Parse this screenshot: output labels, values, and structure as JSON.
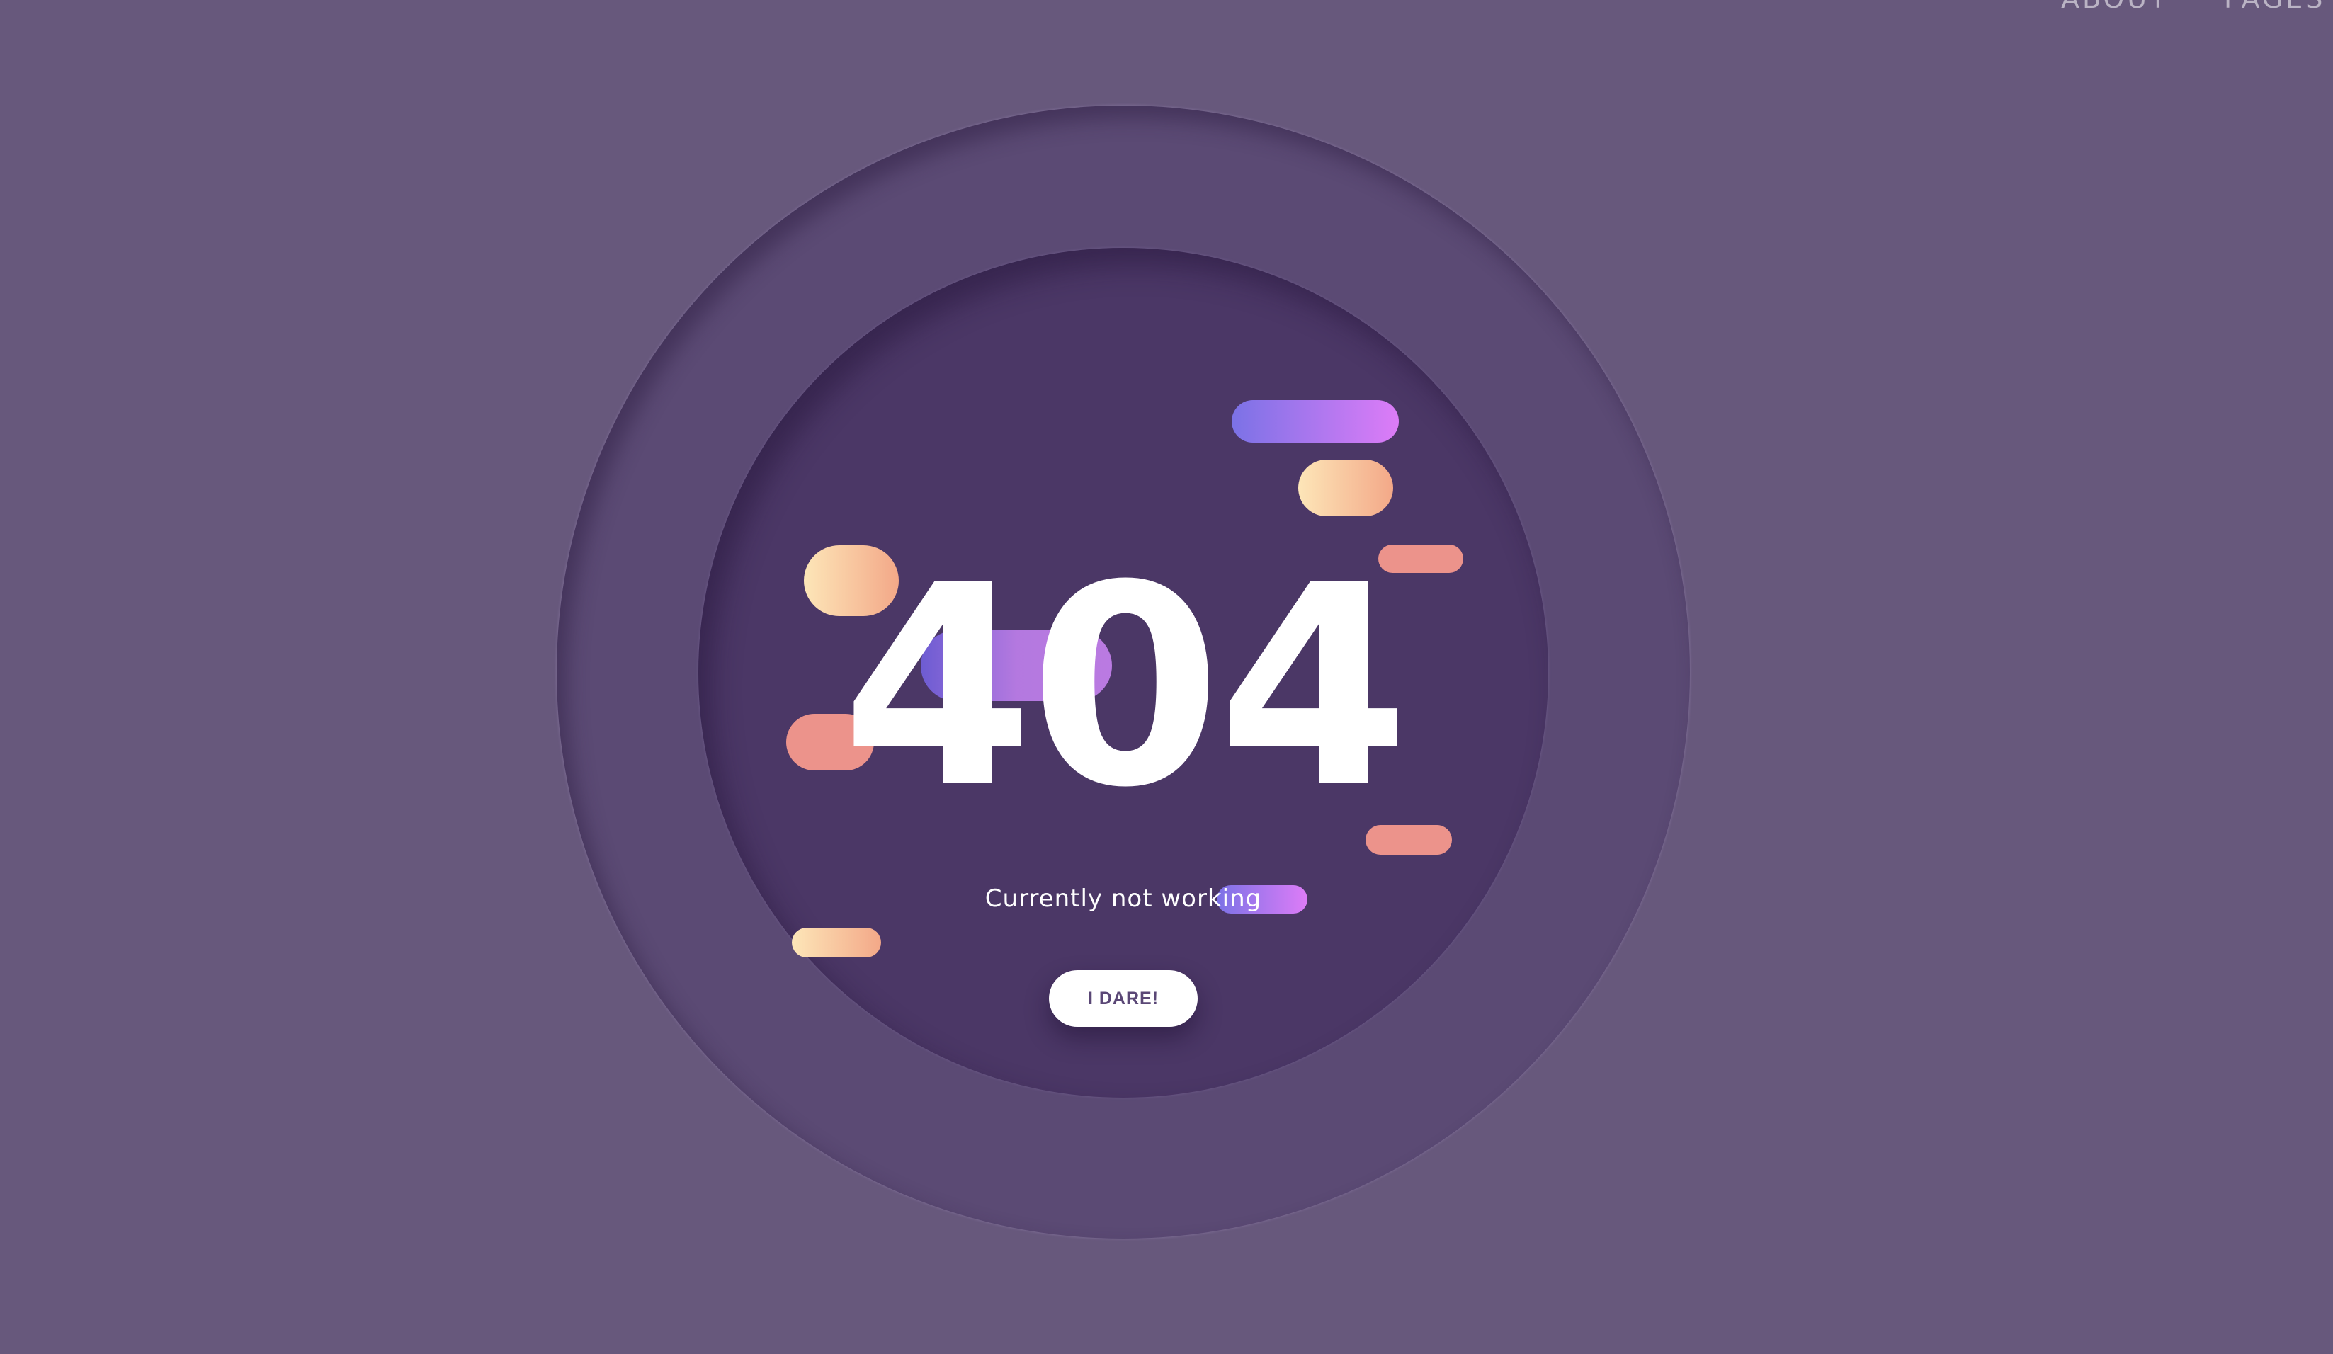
{
  "nav": {
    "links": [
      {
        "label": "ABOUT"
      },
      {
        "label": "PAGES"
      }
    ]
  },
  "error": {
    "code": "404",
    "message": "Currently not working",
    "button_label": "I DARE!"
  },
  "colors": {
    "background": "#67587c",
    "outer_ring": "#5b4a74",
    "inner_ring": "#4b3766",
    "violet_gradient": [
      "#7b72e6",
      "#dd7cf7"
    ],
    "peach_gradient": [
      "#fde6b8",
      "#f3a888"
    ],
    "salmon": "#ec938b"
  }
}
